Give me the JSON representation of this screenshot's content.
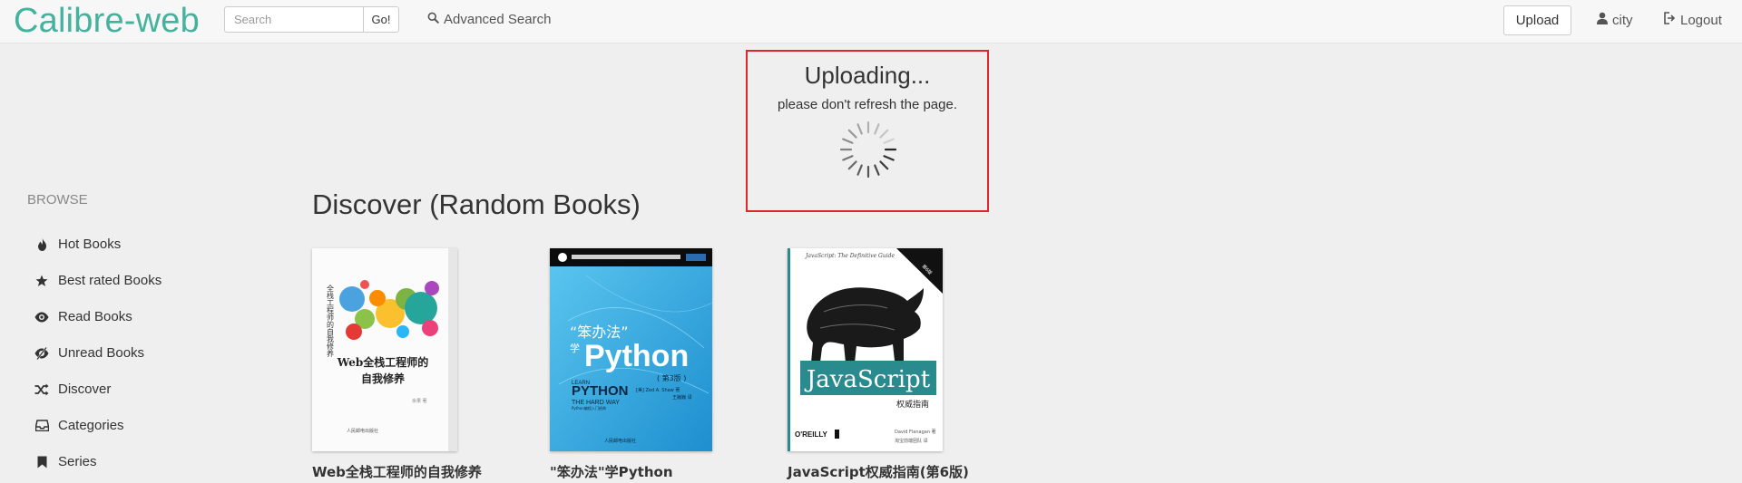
{
  "app": {
    "brand": "Calibre-web"
  },
  "navbar": {
    "search": {
      "placeholder": "Search",
      "value": ""
    },
    "go_label": "Go!",
    "advanced_search_label": "Advanced Search",
    "upload_label": "Upload",
    "user_label": "city",
    "logout_label": "Logout"
  },
  "upload_modal": {
    "title": "Uploading...",
    "message": "please don't refresh the page."
  },
  "sidebar": {
    "header": "BROWSE",
    "items": [
      {
        "label": "Hot Books",
        "icon": "fire-icon"
      },
      {
        "label": "Best rated Books",
        "icon": "star-icon"
      },
      {
        "label": "Read Books",
        "icon": "eye-icon"
      },
      {
        "label": "Unread Books",
        "icon": "eye-slash-icon"
      },
      {
        "label": "Discover",
        "icon": "random-icon"
      },
      {
        "label": "Categories",
        "icon": "inbox-icon"
      },
      {
        "label": "Series",
        "icon": "bookmark-icon"
      }
    ]
  },
  "main": {
    "section_title": "Discover (Random Books)",
    "books": [
      {
        "title": "Web全栈工程师的自我修养",
        "cover_text": "Web全栈工程师的自我修养"
      },
      {
        "title": "\"笨办法\"学Python",
        "cover_top": "“笨办法”",
        "cover_big": "Python",
        "cover_xue": "学",
        "cover_learn": "PYTHON",
        "cover_hard": "THE HARD WAY",
        "cover_edition": "( 第3版 )"
      },
      {
        "title": "JavaScript权威指南(第6版)",
        "cover_guide": "JavaScript: The Definitive Guide",
        "cover_big": "JavaScript",
        "cover_sub": "权威指南",
        "cover_publisher": "O'REILLY"
      }
    ]
  },
  "colors": {
    "brand": "#45b29d",
    "modal_border": "#e0252b",
    "background": "#f0efef"
  }
}
